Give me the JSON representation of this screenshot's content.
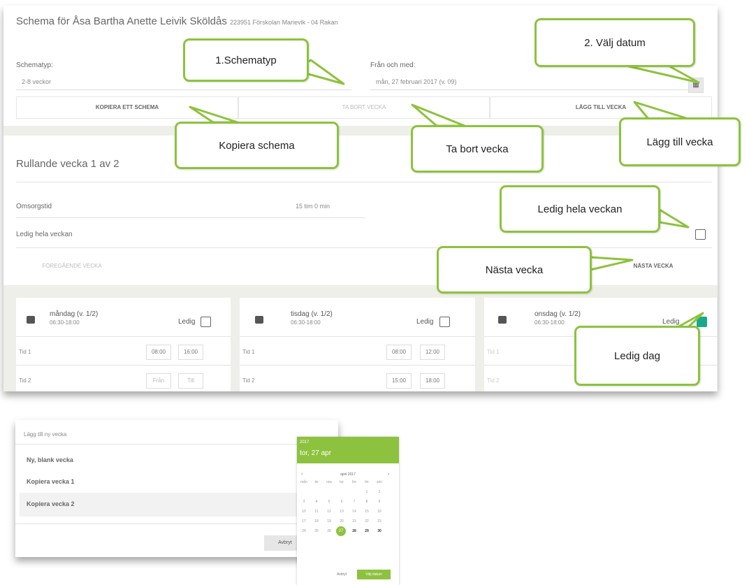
{
  "header": {
    "title": "Schema för Åsa Bartha Anette Leivik Sköldås",
    "subtitle": "223951 Förskolan Marievik - 04 Rakan"
  },
  "schedule_type": {
    "label": "Schematyp:",
    "value": "2-8 veckor"
  },
  "from_date": {
    "label": "Från och med:",
    "value": "mån, 27 februari 2017 (v. 09)"
  },
  "buttons": {
    "copy": "KOPIERA ETT SCHEMA",
    "remove": "TA BORT VECKA",
    "add": "LÄGG TILL VECKA",
    "prev": "FÖREGÅENDE VECKA",
    "next": "NÄSTA VECKA"
  },
  "week": {
    "title": "Rullande vecka 1 av 2"
  },
  "care_time": {
    "label": "Omsorgstid",
    "value": "15 tim 0 min"
  },
  "free_week": {
    "label": "Ledig hela veckan",
    "checked": false
  },
  "days": [
    {
      "name": "måndag (v. 1/2)",
      "hours": "06:30-18:00",
      "ledig": "Ledig",
      "checked": false,
      "rows": [
        {
          "label": "Tid 1",
          "from": "08:00",
          "to": "16:00"
        },
        {
          "label": "Tid 2",
          "from": "Från",
          "to": "Till"
        }
      ]
    },
    {
      "name": "tisdag (v. 1/2)",
      "hours": "06:30-18:00",
      "ledig": "Ledig",
      "checked": false,
      "rows": [
        {
          "label": "Tid 1",
          "from": "08:00",
          "to": "12:00"
        },
        {
          "label": "Tid 2",
          "from": "15:00",
          "to": "18:00"
        }
      ]
    },
    {
      "name": "onsdag (v. 1/2)",
      "hours": "06:30-18:00",
      "ledig": "Ledig",
      "checked": true,
      "rows": [
        {
          "label": "Tid 1",
          "from": "",
          "to": ""
        },
        {
          "label": "Tid 2",
          "from": "",
          "to": ""
        }
      ]
    }
  ],
  "callouts": {
    "schematyp": "1.Schematyp",
    "datum": "2. Välj datum",
    "kopiera": "Kopiera schema",
    "ta_bort": "Ta bort vecka",
    "lagg_till": "Lägg till vecka",
    "ledig_vecka": "Ledig hela veckan",
    "nasta": "Nästa vecka",
    "ledig_dag": "Ledig dag"
  },
  "dialog": {
    "title": "Lägg till ny vecka",
    "items": [
      "Ny, blank vecka",
      "Kopiera vecka 1",
      "Kopiera vecka 2"
    ],
    "cancel": "Avbryt"
  },
  "datepicker": {
    "year": "2017",
    "selected": "tor, 27 apr",
    "month": "april 2017",
    "weekdays": [
      "mån",
      "tis",
      "ons",
      "tor",
      "fre",
      "lör",
      "sön"
    ],
    "cancel": "Avbryt",
    "ok": "Välj datum"
  },
  "colors": {
    "accent": "#8dc23e",
    "checked": "#1aa88a"
  }
}
